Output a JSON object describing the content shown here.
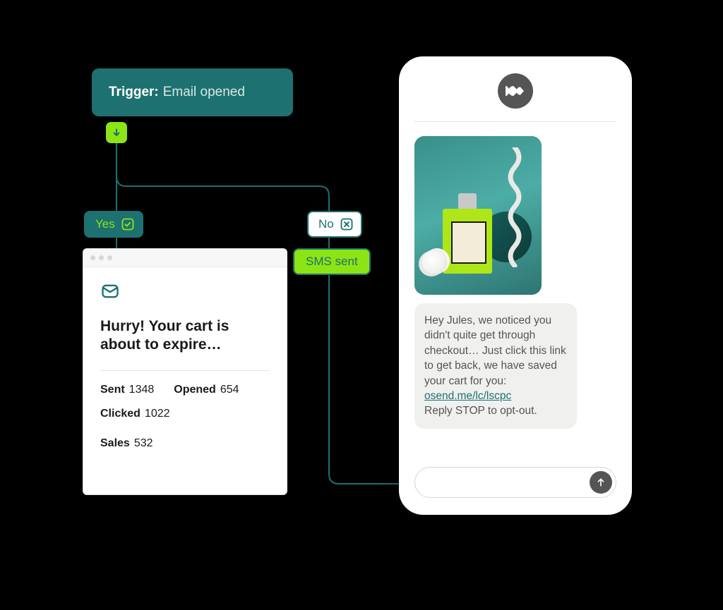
{
  "trigger": {
    "label_prefix": "Trigger:",
    "label": "Email opened"
  },
  "branch": {
    "yes_label": "Yes",
    "no_label": "No",
    "sms_sent_label": "SMS sent"
  },
  "email_card": {
    "subject": "Hurry! Your cart is about to expire…",
    "stats": {
      "sent": {
        "label": "Sent",
        "value": "1348"
      },
      "opened": {
        "label": "Opened",
        "value": "654"
      },
      "clicked": {
        "label": "Clicked",
        "value": "1022"
      },
      "sales": {
        "label": "Sales",
        "value": "532"
      }
    }
  },
  "sms": {
    "body_pre": "Hey Jules, we noticed you didn't quite get through checkout… Just click this link to get back, we have saved your cart for you: ",
    "link_text": "osend.me/lc/lscpc",
    "body_post": "Reply STOP to opt-out."
  },
  "phone": {
    "input_placeholder": ""
  }
}
